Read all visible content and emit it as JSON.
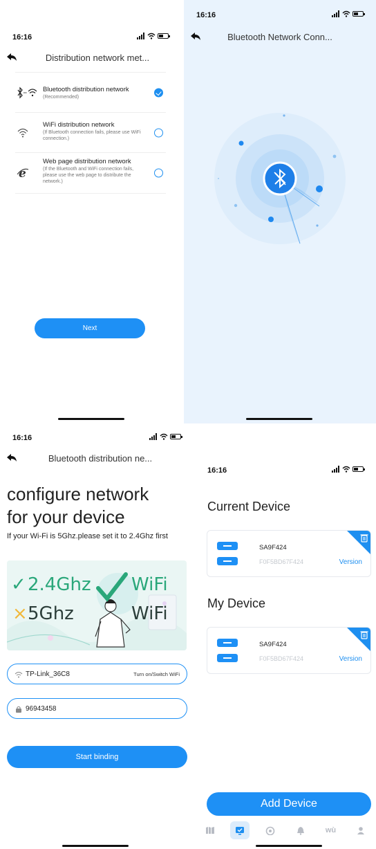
{
  "screen1": {
    "status_time": "16:16",
    "nav_title": "Distribution network met...",
    "methods": [
      {
        "title": "Bluetooth distribution network",
        "desc": "(Recommended)",
        "icon": "bluetooth-wifi-icon",
        "selected": true
      },
      {
        "title": "WiFi distribution network",
        "desc": "(If Bluetooth connection fails, please use WiFi connection.)",
        "icon": "wifi-icon",
        "selected": false
      },
      {
        "title": "Web page distribution network",
        "desc": "(If the Bluetooth and WiFi connection fails, please use the web page to distribute the network.)",
        "icon": "browser-e-icon",
        "selected": false
      }
    ],
    "next_label": "Next"
  },
  "screen2": {
    "status_time": "16:16",
    "nav_title": "Bluetooth Network Conn..."
  },
  "screen3": {
    "status_time": "16:16",
    "nav_title": "Bluetooth distribution ne...",
    "title_line1": "configure network",
    "title_line2": "for your device",
    "hint": "If your Wi-Fi is 5Ghz.please set it to 2.4Ghz first",
    "banner": {
      "good_band": "2.4Ghz",
      "bad_band": "5Ghz",
      "wifi_label": "WiFi",
      "check_mark": "✓",
      "cross_mark": "×"
    },
    "wifi_value": "TP-Link_36C8",
    "wifi_action": "Turn on/Switch WiFi",
    "password_value": "96943458",
    "start_label": "Start binding"
  },
  "screen4": {
    "status_time": "16:16",
    "current_title": "Current Device",
    "my_title": "My Device",
    "current_device": {
      "name": "SA9F424",
      "mac": "F0F5BD67F424",
      "version_label": "Version"
    },
    "my_device": {
      "name": "SA9F424",
      "mac": "F0F5BD67F424",
      "version_label": "Version"
    },
    "add_label": "Add Device",
    "tabs": [
      {
        "icon": "map-icon",
        "active": false
      },
      {
        "icon": "device-check-icon",
        "active": true
      },
      {
        "icon": "gauge-icon",
        "active": false
      },
      {
        "icon": "bell-icon",
        "active": false
      },
      {
        "icon": "wu-icon",
        "text": "wù",
        "active": false
      },
      {
        "icon": "user-icon",
        "active": false
      }
    ]
  },
  "colors": {
    "accent": "#1e90f5",
    "radar_bg": "#e9f3fd",
    "muted_text": "#c5c9cf"
  }
}
